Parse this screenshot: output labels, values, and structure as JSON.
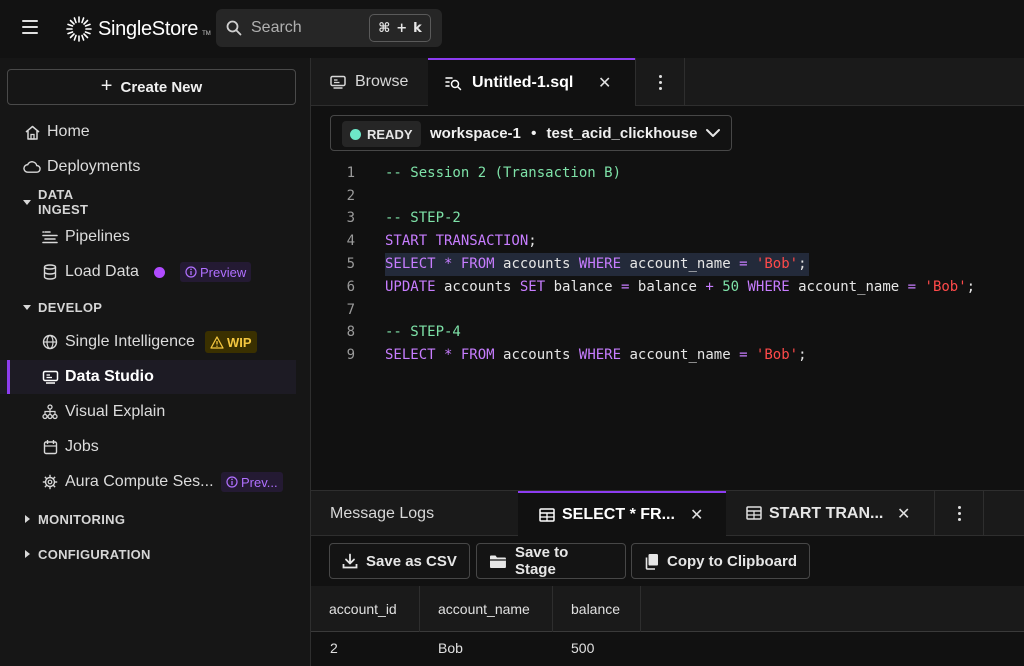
{
  "topbar": {
    "logo_text": "SingleStore",
    "logo_tm": "TM",
    "search_placeholder": "Search",
    "shortcut_cmd": "⌘",
    "shortcut_plus": "+",
    "shortcut_key": "k"
  },
  "sidebar": {
    "create_new_label": "Create New",
    "items": {
      "home": "Home",
      "deployments": "Deployments",
      "pipelines": "Pipelines",
      "load_data": "Load Data",
      "single_intelligence": "Single Intelligence",
      "data_studio": "Data Studio",
      "visual_explain": "Visual Explain",
      "jobs": "Jobs",
      "aura_compute": "Aura Compute Ses..."
    },
    "sections": {
      "data_ingest": "DATA INGEST",
      "develop": "DEVELOP",
      "monitoring": "MONITORING",
      "configuration": "CONFIGURATION"
    },
    "badges": {
      "preview": "Preview",
      "preview_truncated": "Prev...",
      "wip": "WIP"
    }
  },
  "tabs": {
    "browse": "Browse",
    "untitled": "Untitled-1.sql"
  },
  "workspace": {
    "status": "READY",
    "name": "workspace-1",
    "separator": "•",
    "database": "test_acid_clickhouse"
  },
  "editor": {
    "line_numbers": [
      "1",
      "2",
      "3",
      "4",
      "5",
      "6",
      "7",
      "8",
      "9"
    ],
    "tokens": {
      "l1": "-- Session 2 (Transaction B)",
      "l3": "-- STEP-2",
      "l4_kw": "START TRANSACTION",
      "l4_end": ";",
      "l5_kw1": "SELECT",
      "l5_op": " * ",
      "l5_kw2": "FROM",
      "l5_tbl": " accounts ",
      "l5_kw3": "WHERE",
      "l5_col": " account_name ",
      "l5_eq": "=",
      "l5_str": " 'Bob'",
      "l5_end": ";",
      "l6_kw1": "UPDATE",
      "l6_tbl": " accounts ",
      "l6_kw2": "SET",
      "l6_col": " balance ",
      "l6_eq": "=",
      "l6_col2": " balance ",
      "l6_plus": "+",
      "l6_num": " 50 ",
      "l6_kw3": "WHERE",
      "l6_col3": " account_name ",
      "l6_eq2": "=",
      "l6_str": " 'Bob'",
      "l6_end": ";",
      "l8": "-- STEP-4",
      "l9_kw1": "SELECT",
      "l9_op": " * ",
      "l9_kw2": "FROM",
      "l9_tbl": " accounts ",
      "l9_kw3": "WHERE",
      "l9_col": " account_name ",
      "l9_eq": "=",
      "l9_str": " 'Bob'",
      "l9_end": ";"
    }
  },
  "results": {
    "tabs": {
      "message_logs": "Message Logs",
      "select": "SELECT * FR...",
      "start": "START TRAN..."
    },
    "actions": {
      "save_csv": "Save as CSV",
      "save_stage": "Save to Stage",
      "copy": "Copy to Clipboard"
    },
    "columns": [
      "account_id",
      "account_name",
      "balance"
    ],
    "rows": [
      [
        "2",
        "Bob",
        "500"
      ]
    ]
  }
}
